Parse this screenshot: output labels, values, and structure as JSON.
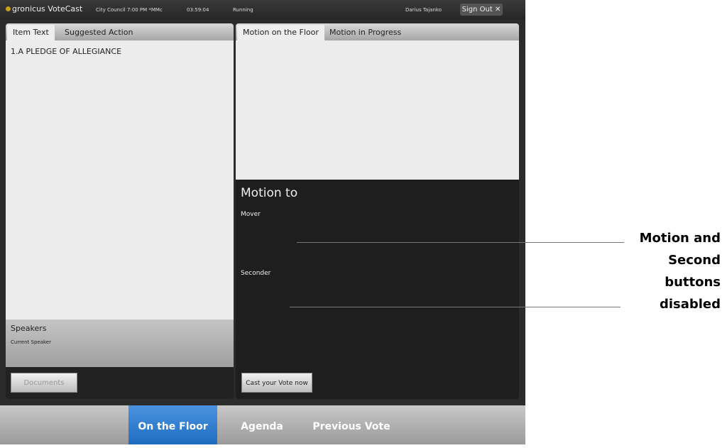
{
  "topbar": {
    "logo": "gronicus VoteCast",
    "meeting": "City Council 7:00 PM *MMc",
    "time": "03:59:04",
    "status": "Running",
    "user": "Darius Tajanko",
    "signout": "Sign Out ✕"
  },
  "left": {
    "tabs": [
      "Item Text",
      "Suggested Action"
    ],
    "item": "1.A  PLEDGE OF ALLEGIANCE",
    "speakers_title": "Speakers",
    "current_speaker": "Current Speaker",
    "documents": "Documents"
  },
  "right": {
    "tabs": [
      "Motion on the Floor",
      "Motion in Progress"
    ],
    "motion_to": "Motion to",
    "mover": "Mover",
    "seconder": "Seconder",
    "cast_vote": "Cast your Vote now"
  },
  "nav": {
    "items": [
      "On the Floor",
      "Agenda",
      "Previous Vote"
    ],
    "active_color": "#2e7fd6"
  },
  "annotation": [
    "Motion and",
    "Second",
    "buttons",
    "disabled"
  ]
}
